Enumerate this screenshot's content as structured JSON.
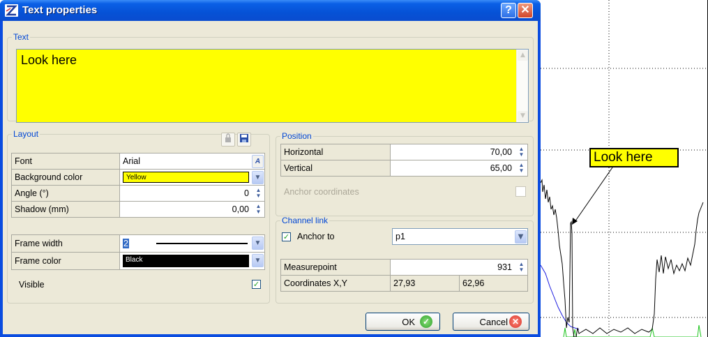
{
  "window": {
    "title": "Text properties"
  },
  "text_group": {
    "legend": "Text",
    "content": "Look here"
  },
  "layout_group": {
    "legend": "Layout",
    "rows": {
      "font": {
        "label": "Font",
        "value": "Arial"
      },
      "background_color": {
        "label": "Background color",
        "value": "Yellow",
        "color": "#ffff00"
      },
      "angle": {
        "label": "Angle (°)",
        "value": "0"
      },
      "shadow": {
        "label": "Shadow (mm)",
        "value": "0,00"
      },
      "frame_width": {
        "label": "Frame width",
        "value": "2"
      },
      "frame_color": {
        "label": "Frame color",
        "value": "Black",
        "color": "#000000"
      }
    },
    "visible": {
      "label": "Visible",
      "checked": true
    }
  },
  "position_group": {
    "legend": "Position",
    "horizontal": {
      "label": "Horizontal",
      "value": "70,00"
    },
    "vertical": {
      "label": "Vertical",
      "value": "65,00"
    },
    "anchor_coordinates": {
      "label": "Anchor coordinates",
      "checked": false
    }
  },
  "channel_group": {
    "legend": "Channel link",
    "anchor_to": {
      "label": "Anchor to",
      "value": "p1",
      "checked": true
    },
    "measurepoint": {
      "label": "Measurepoint",
      "value": "931"
    },
    "coordinates": {
      "label": "Coordinates X,Y",
      "x": "27,93",
      "y": "62,96"
    }
  },
  "buttons": {
    "ok": "OK",
    "cancel": "Cancel"
  },
  "chart_annotation": {
    "text": "Look here",
    "background": "#ffff00"
  },
  "colors": {
    "accent": "#0046d5",
    "titlebar": "#0a5fe6",
    "panel": "#ece9d8"
  }
}
